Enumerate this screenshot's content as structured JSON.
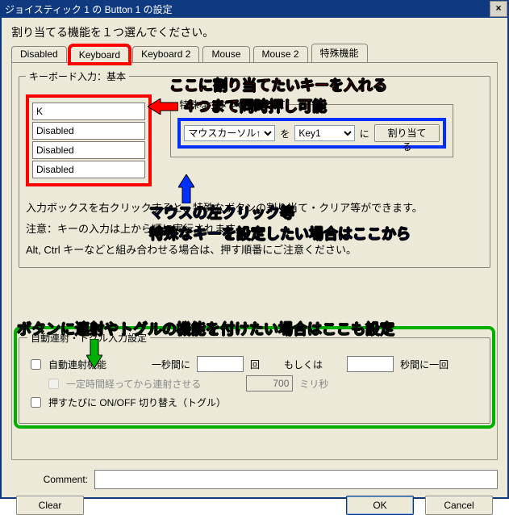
{
  "window": {
    "title": "ジョイスティック 1 の Button 1 の設定",
    "close_icon": "×"
  },
  "instruction": "割り当てる機能を１つ選んでください。",
  "tabs": {
    "disabled": "Disabled",
    "keyboard": "Keyboard",
    "keyboard2": "Keyboard 2",
    "mouse": "Mouse",
    "mouse2": "Mouse 2",
    "special": "特殊機能"
  },
  "basic_group": {
    "legend": "キーボード入力：基本",
    "key_inputs": [
      "K",
      "Disabled",
      "Disabled",
      "Disabled"
    ]
  },
  "special_group": {
    "legend": "特殊なボタンの割り当て",
    "cursor_select": "マウスカーソル↑",
    "wo": "を",
    "key_select": "Key1",
    "ni": "に",
    "assign_btn": "割り当てる"
  },
  "notes": {
    "line1": "入力ボックスを右クリックすると、特殊なボタンの割り当て・クリア等ができます。",
    "line2": "注意：キーの入力は上から順に実行されます。",
    "line3": "Alt, Ctrl キーなどと組み合わせる場合は、押す順番にご注意ください。"
  },
  "annotations": {
    "red1": "ここに割り当てたいキーを入れる",
    "red2": "４つまで同時押し可能",
    "blue1": "マウスの左クリック等",
    "blue2": "特殊なキーを設定したい場合はここから",
    "green1": "ボタンに連射やトグルの機能を付けたい場合はここも設定"
  },
  "autofire": {
    "legend": "自動連射・トグル入力設定",
    "auto_label": "自動連射機能",
    "per_sec_pre": "一秒間に",
    "per_sec_val": "",
    "per_sec_suf": "回",
    "or_label": "もしくは",
    "per_n_val": "",
    "per_n_suf": "秒間に一回",
    "delay_label": "一定時間経ってから連射させる",
    "delay_val": "700",
    "delay_unit": "ミリ秒",
    "toggle_label": "押すたびに ON/OFF 切り替え（トグル）"
  },
  "comment": {
    "label": "Comment:",
    "value": ""
  },
  "buttons": {
    "clear": "Clear",
    "ok": "OK",
    "cancel": "Cancel"
  }
}
